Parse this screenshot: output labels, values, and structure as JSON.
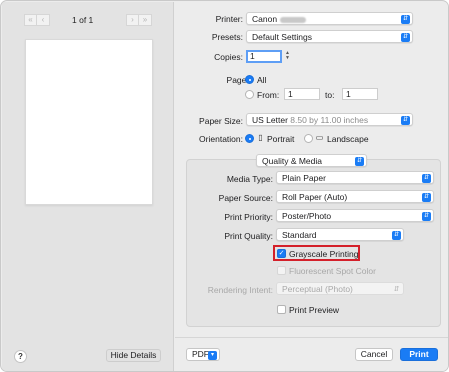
{
  "preview": {
    "page_indicator": "1 of 1",
    "nav_first": "«",
    "nav_prev": "‹",
    "nav_next": "›",
    "nav_last": "»"
  },
  "printer": {
    "label": "Printer:",
    "value": "Canon"
  },
  "presets": {
    "label": "Presets:",
    "value": "Default Settings"
  },
  "copies": {
    "label": "Copies:",
    "value": "1"
  },
  "pages": {
    "label": "Pages:",
    "all_label": "All",
    "from_label": "From:",
    "from_value": "1",
    "to_label": "to:",
    "to_value": "1",
    "selected": "All"
  },
  "paper_size": {
    "label": "Paper Size:",
    "value": "US Letter",
    "detail": "8.50 by 11.00 inches"
  },
  "orientation": {
    "label": "Orientation:",
    "portrait": "Portrait",
    "landscape": "Landscape",
    "selected": "Portrait"
  },
  "section": {
    "value": "Quality & Media"
  },
  "media_type": {
    "label": "Media Type:",
    "value": "Plain Paper"
  },
  "paper_source": {
    "label": "Paper Source:",
    "value": "Roll Paper (Auto)"
  },
  "print_priority": {
    "label": "Print Priority:",
    "value": "Poster/Photo"
  },
  "print_quality": {
    "label": "Print Quality:",
    "value": "Standard"
  },
  "grayscale": {
    "label": "Grayscale Printing",
    "checked": true
  },
  "fluorescent": {
    "label": "Fluorescent Spot Color",
    "checked": false,
    "enabled": false
  },
  "rendering_intent": {
    "label": "Rendering Intent:",
    "value": "Perceptual (Photo)",
    "enabled": false
  },
  "print_preview": {
    "label": "Print Preview",
    "checked": false
  },
  "footer": {
    "help": "?",
    "hide_details": "Hide Details",
    "pdf": "PDF",
    "cancel": "Cancel",
    "print": "Print"
  },
  "colors": {
    "accent": "#1a7cf5",
    "highlight": "#d4202a"
  }
}
